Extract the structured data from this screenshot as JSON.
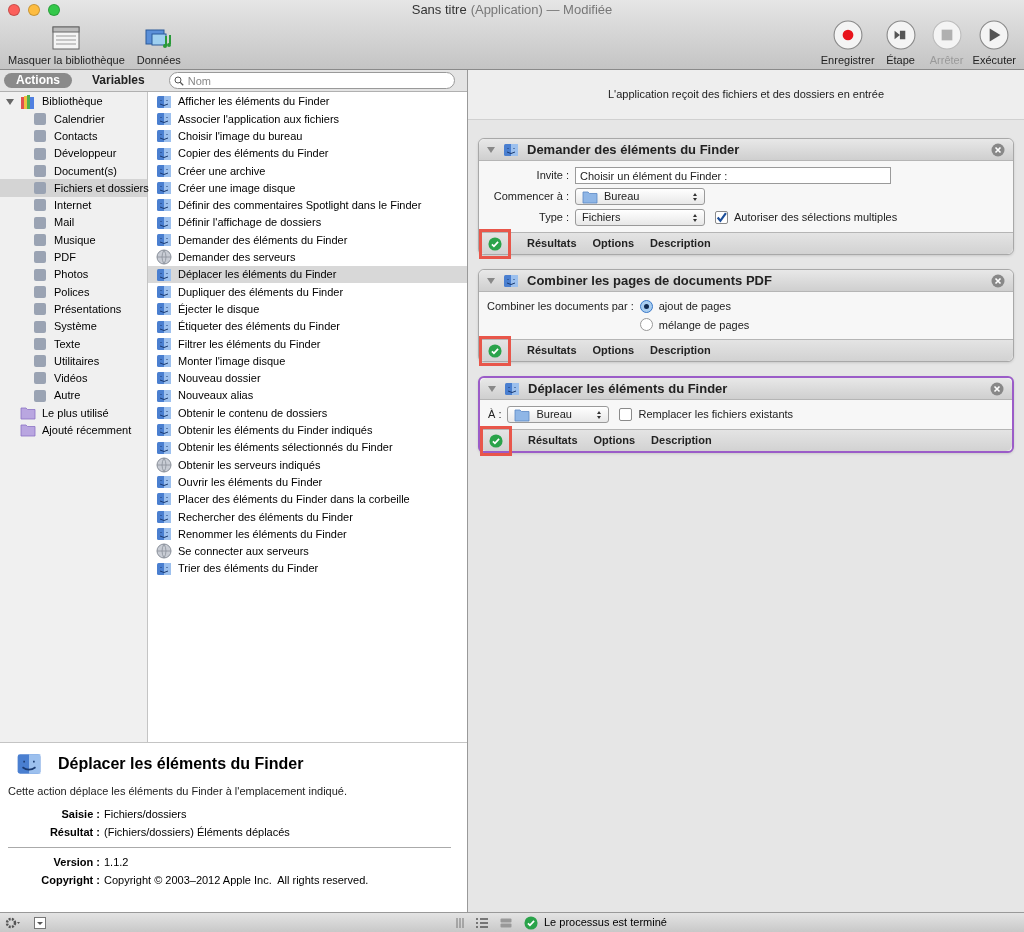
{
  "window": {
    "title": "Sans titre",
    "title_suffix": "(Application) — Modifiée"
  },
  "toolbar": {
    "left": [
      {
        "label": "Masquer la bibliothèque",
        "kind": "library"
      },
      {
        "label": "Données",
        "kind": "media"
      }
    ],
    "right": [
      {
        "label": "Enregistrer",
        "kind": "record",
        "disabled": false
      },
      {
        "label": "Étape",
        "kind": "step",
        "disabled": false
      },
      {
        "label": "Arrêter",
        "kind": "stop",
        "disabled": true
      },
      {
        "label": "Exécuter",
        "kind": "run",
        "disabled": false
      }
    ]
  },
  "tabs": [
    {
      "label": "Actions",
      "selected": true
    },
    {
      "label": "Variables",
      "selected": false
    }
  ],
  "search": {
    "placeholder": "Nom"
  },
  "library": [
    {
      "label": "Bibliothèque",
      "kind": "library",
      "expanded": true,
      "selected": false,
      "children": [
        {
          "label": "Calendrier",
          "selected": false
        },
        {
          "label": "Contacts",
          "selected": false
        },
        {
          "label": "Développeur",
          "selected": false
        },
        {
          "label": "Document(s)",
          "selected": false
        },
        {
          "label": "Fichiers et dossiers",
          "selected": true
        },
        {
          "label": "Internet",
          "selected": false
        },
        {
          "label": "Mail",
          "selected": false
        },
        {
          "label": "Musique",
          "selected": false
        },
        {
          "label": "PDF",
          "selected": false
        },
        {
          "label": "Photos",
          "selected": false
        },
        {
          "label": "Polices",
          "selected": false
        },
        {
          "label": "Présentations",
          "selected": false
        },
        {
          "label": "Système",
          "selected": false
        },
        {
          "label": "Texte",
          "selected": false
        },
        {
          "label": "Utilitaires",
          "selected": false
        },
        {
          "label": "Vidéos",
          "selected": false
        },
        {
          "label": "Autre",
          "selected": false
        }
      ]
    },
    {
      "label": "Le plus utilisé",
      "kind": "folder",
      "selected": false
    },
    {
      "label": "Ajouté récemment",
      "kind": "folder",
      "selected": false
    }
  ],
  "actions": [
    {
      "label": "Afficher les éléments du Finder",
      "kind": "finder",
      "selected": false
    },
    {
      "label": "Associer l'application aux fichiers",
      "kind": "finder",
      "selected": false
    },
    {
      "label": "Choisir l'image du bureau",
      "kind": "finder",
      "selected": false
    },
    {
      "label": "Copier des éléments du Finder",
      "kind": "finder",
      "selected": false
    },
    {
      "label": "Créer une archive",
      "kind": "finder",
      "selected": false
    },
    {
      "label": "Créer une image disque",
      "kind": "finder",
      "selected": false
    },
    {
      "label": "Définir des commentaires Spotlight dans le Finder",
      "kind": "finder",
      "selected": false
    },
    {
      "label": "Définir l'affichage de dossiers",
      "kind": "finder",
      "selected": false
    },
    {
      "label": "Demander des éléments du Finder",
      "kind": "finder",
      "selected": false
    },
    {
      "label": "Demander des serveurs",
      "kind": "server",
      "selected": false
    },
    {
      "label": "Déplacer les éléments du Finder",
      "kind": "finder",
      "selected": true
    },
    {
      "label": "Dupliquer des éléments du Finder",
      "kind": "finder",
      "selected": false
    },
    {
      "label": "Éjecter le disque",
      "kind": "finder",
      "selected": false
    },
    {
      "label": "Étiqueter des éléments du Finder",
      "kind": "finder",
      "selected": false
    },
    {
      "label": "Filtrer les éléments du Finder",
      "kind": "finder",
      "selected": false
    },
    {
      "label": "Monter l'image disque",
      "kind": "finder",
      "selected": false
    },
    {
      "label": "Nouveau dossier",
      "kind": "finder",
      "selected": false
    },
    {
      "label": "Nouveaux alias",
      "kind": "finder",
      "selected": false
    },
    {
      "label": "Obtenir le contenu de dossiers",
      "kind": "finder",
      "selected": false
    },
    {
      "label": "Obtenir les éléments du Finder indiqués",
      "kind": "finder",
      "selected": false
    },
    {
      "label": "Obtenir les éléments sélectionnés du Finder",
      "kind": "finder",
      "selected": false
    },
    {
      "label": "Obtenir les serveurs indiqués",
      "kind": "server",
      "selected": false
    },
    {
      "label": "Ouvrir les éléments du Finder",
      "kind": "finder",
      "selected": false
    },
    {
      "label": "Placer des éléments du Finder dans la corbeille",
      "kind": "finder",
      "selected": false
    },
    {
      "label": "Rechercher des éléments du Finder",
      "kind": "finder",
      "selected": false
    },
    {
      "label": "Renommer les éléments du Finder",
      "kind": "finder",
      "selected": false
    },
    {
      "label": "Se connecter aux serveurs",
      "kind": "server",
      "selected": false
    },
    {
      "label": "Trier des éléments du Finder",
      "kind": "finder",
      "selected": false
    }
  ],
  "description": {
    "title": "Déplacer les éléments du Finder",
    "text": "Cette action déplace les éléments du Finder à l'emplacement indiqué.",
    "fields": [
      {
        "label": "Saisie :",
        "value": "Fichiers/dossiers"
      },
      {
        "label": "Résultat :",
        "value": "(Fichiers/dossiers) Éléments déplacés"
      }
    ],
    "meta": [
      {
        "label": "Version :",
        "value": "1.1.2"
      },
      {
        "label": "Copyright :",
        "value": "Copyright © 2003–2012 Apple Inc.  All rights reserved."
      }
    ]
  },
  "workflow": {
    "input_text": "L'application reçoit des fichiers et des dossiers en entrée",
    "blocks": [
      {
        "title": "Demander des éléments du Finder",
        "selected": false,
        "highlighted": true,
        "footer": [
          "Résultats",
          "Options",
          "Description"
        ],
        "rows": [
          {
            "kind": "text",
            "label": "Invite :",
            "value": "Choisir un élément du Finder :"
          },
          {
            "kind": "popup",
            "label": "Commencer à :",
            "value": "Bureau",
            "folder": true
          },
          {
            "kind": "popup",
            "label": "Type :",
            "value": "Fichiers",
            "folder": false,
            "checkbox": {
              "label": "Autoriser des sélections multiples",
              "checked": true
            }
          }
        ]
      },
      {
        "title": "Combiner les pages de documents PDF",
        "selected": false,
        "highlighted": true,
        "footer": [
          "Résultats",
          "Options",
          "Description"
        ],
        "rows": [
          {
            "kind": "radio",
            "label": "Combiner les documents par :",
            "options": [
              {
                "label": "ajout de pages",
                "selected": true
              },
              {
                "label": "mélange de pages",
                "selected": false
              }
            ]
          }
        ]
      },
      {
        "title": "Déplacer les éléments du Finder",
        "selected": true,
        "highlighted": true,
        "footer": [
          "Résultats",
          "Options",
          "Description"
        ],
        "rows": [
          {
            "kind": "popup",
            "label": "À :",
            "value": "Bureau",
            "folder": true,
            "compact": true,
            "checkbox": {
              "label": "Remplacer les fichiers existants",
              "checked": false
            }
          }
        ]
      }
    ]
  },
  "status": {
    "text": "Le processus est terminé"
  }
}
